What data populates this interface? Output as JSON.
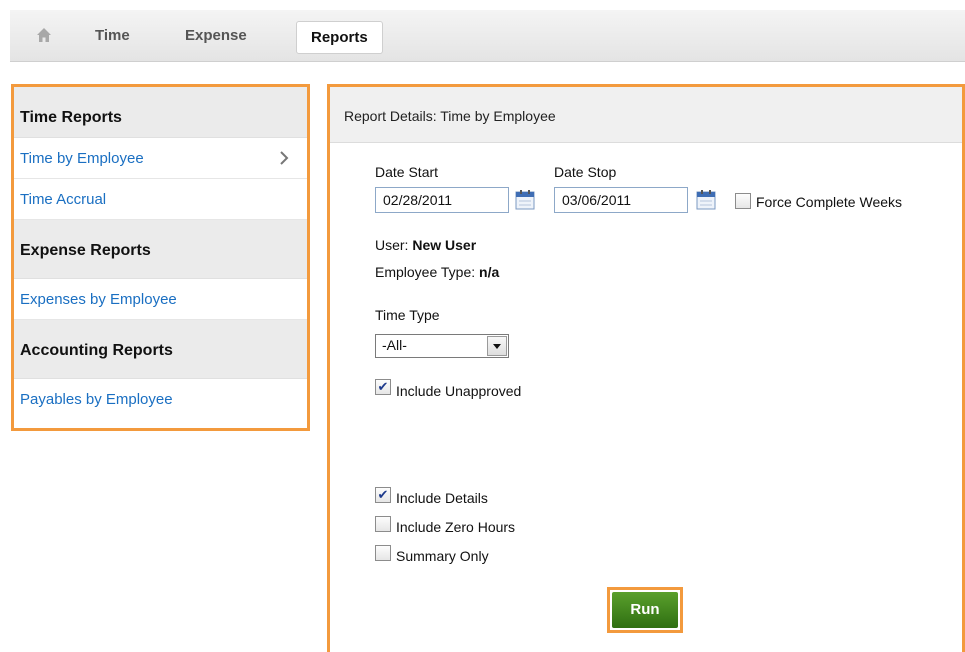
{
  "nav": {
    "home_icon": "home-icon",
    "items": [
      {
        "label": "Time"
      },
      {
        "label": "Expense"
      },
      {
        "label": "Reports"
      }
    ]
  },
  "sidebar": {
    "sections": [
      {
        "heading": "Time Reports",
        "items": [
          "Time by Employee",
          "Time Accrual"
        ]
      },
      {
        "heading": "Expense Reports",
        "items": [
          "Expenses by Employee"
        ]
      },
      {
        "heading": "Accounting Reports",
        "items": [
          "Payables by Employee"
        ]
      }
    ],
    "active_item": "Time by Employee"
  },
  "panel": {
    "title": "Report Details: Time by Employee",
    "date_start_label": "Date Start",
    "date_start_value": "02/28/2011",
    "date_stop_label": "Date Stop",
    "date_stop_value": "03/06/2011",
    "force_complete_weeks_label": "Force Complete Weeks",
    "user_label": "User:",
    "user_value": "New User",
    "employee_type_label": "Employee Type:",
    "employee_type_value": "n/a",
    "time_type_label": "Time Type",
    "time_type_selected": "-All-",
    "include_unapproved_label": "Include Unapproved",
    "include_details_label": "Include Details",
    "include_zero_hours_label": "Include Zero Hours",
    "summary_only_label": "Summary Only",
    "run_label": "Run"
  },
  "colors": {
    "highlight": "#f39a3d",
    "link": "#1a6fc2",
    "run_button": "#3f8a1c"
  }
}
